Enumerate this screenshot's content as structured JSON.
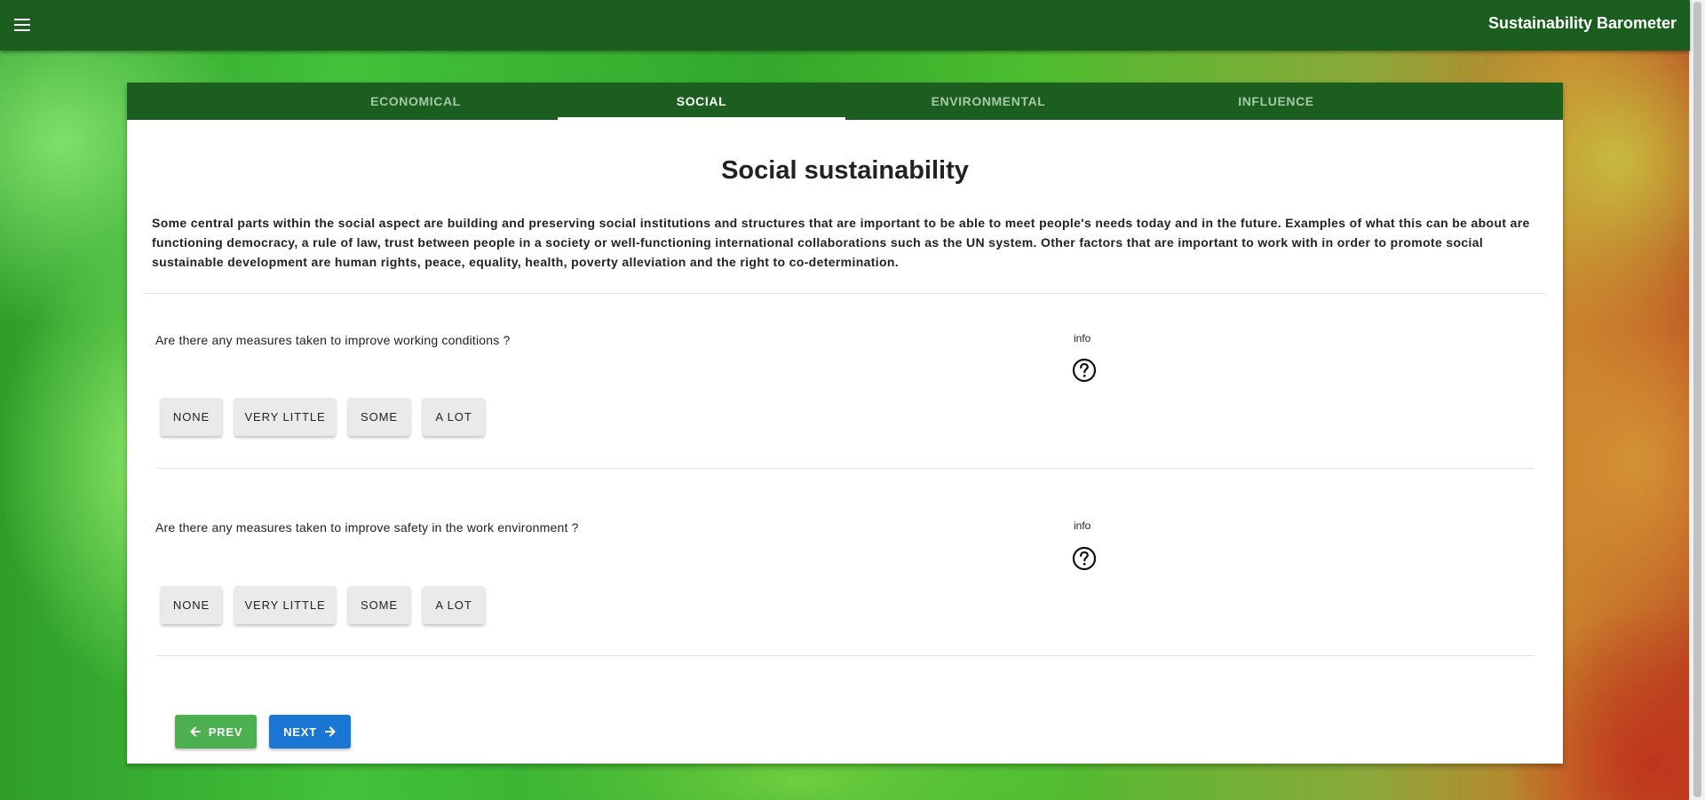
{
  "appbar": {
    "title": "Sustainability Barometer",
    "menu_icon": "menu-icon"
  },
  "tabs": [
    {
      "label": "ECONOMICAL",
      "active": false
    },
    {
      "label": "SOCIAL",
      "active": true
    },
    {
      "label": "ENVIRONMENTAL",
      "active": false
    },
    {
      "label": "INFLUENCE",
      "active": false
    }
  ],
  "section": {
    "title": "Social sustainability",
    "description": "Some central parts within the social aspect are building and preserving social institutions and structures that are important to be able to meet people's needs today and in the future. Examples of what this can be about are functioning democracy, a rule of law, trust between people in a society or well-functioning international collaborations such as the UN system. Other factors that are important to work with in order to promote social sustainable development are human rights, peace, equality, health, poverty alleviation and the right to co-determination."
  },
  "questions": [
    {
      "text": "Are there any measures taken to improve working conditions ?",
      "info_label": "info",
      "info_icon": "help-circle-icon",
      "options": [
        "NONE",
        "VERY LITTLE",
        "SOME",
        "A LOT"
      ]
    },
    {
      "text": "Are there any measures taken to improve safety in the work environment ?",
      "info_label": "info",
      "info_icon": "help-circle-icon",
      "options": [
        "NONE",
        "VERY LITTLE",
        "SOME",
        "A LOT"
      ]
    }
  ],
  "navigation": {
    "prev_label": "PREV",
    "next_label": "NEXT",
    "prev_color": "#4caf50",
    "next_color": "#1976d2"
  },
  "colors": {
    "primary": "#1b5e20",
    "active_tab_text": "#ffffff",
    "inactive_tab_text": "#a5c8a7"
  }
}
